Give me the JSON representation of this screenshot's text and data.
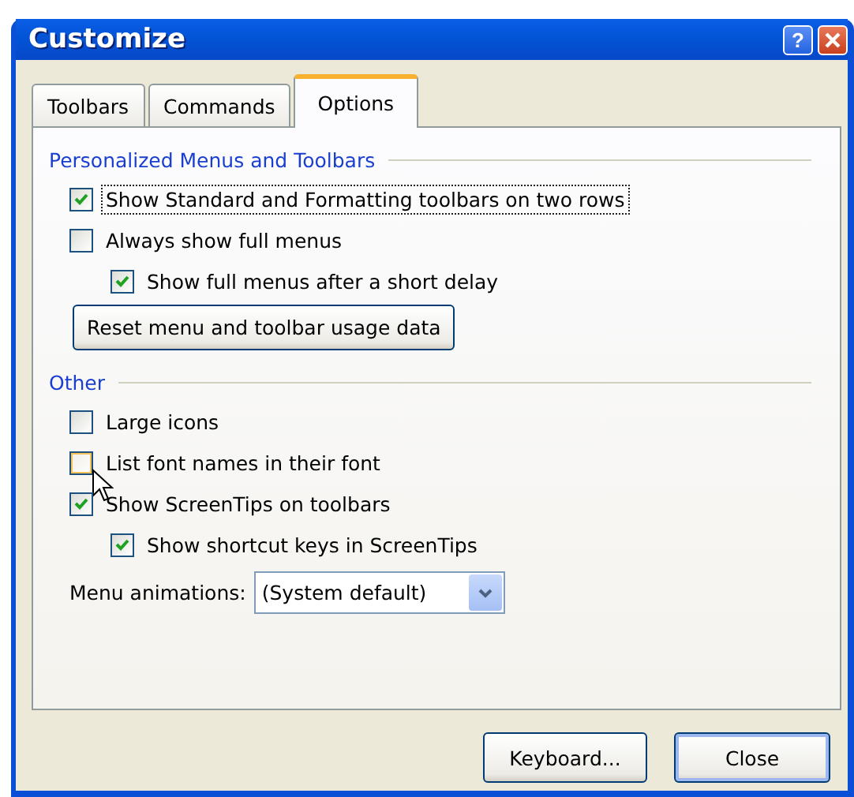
{
  "window": {
    "title": "Customize",
    "help_button": "?"
  },
  "tabs": [
    {
      "label": "Toolbars",
      "selected": false
    },
    {
      "label": "Commands",
      "selected": false
    },
    {
      "label": "Options",
      "selected": true
    }
  ],
  "sections": [
    {
      "heading": "Personalized Menus and Toolbars",
      "items": [
        {
          "kind": "checkbox",
          "label": "Show Standard and Formatting toolbars on two rows",
          "checked": true,
          "focused": true,
          "hovered": false
        },
        {
          "kind": "checkbox",
          "label": "Always show full menus",
          "checked": false,
          "focused": false,
          "hovered": false,
          "children": [
            {
              "kind": "checkbox",
              "label": "Show full menus after a short delay",
              "checked": true,
              "focused": false,
              "hovered": false
            }
          ]
        },
        {
          "kind": "button",
          "label": "Reset menu and toolbar usage data"
        }
      ]
    },
    {
      "heading": "Other",
      "items": [
        {
          "kind": "checkbox",
          "label": "Large icons",
          "checked": false,
          "focused": false,
          "hovered": false
        },
        {
          "kind": "checkbox",
          "label": "List font names in their font",
          "checked": false,
          "focused": false,
          "hovered": true
        },
        {
          "kind": "checkbox",
          "label": "Show ScreenTips on toolbars",
          "checked": true,
          "focused": false,
          "hovered": false,
          "children": [
            {
              "kind": "checkbox",
              "label": "Show shortcut keys in ScreenTips",
              "checked": true,
              "focused": false,
              "hovered": false
            }
          ]
        },
        {
          "kind": "dropdown",
          "label": "Menu animations:",
          "value": "(System default)"
        }
      ]
    }
  ],
  "buttons": [
    {
      "label": "Keyboard..."
    },
    {
      "label": "Close"
    }
  ]
}
